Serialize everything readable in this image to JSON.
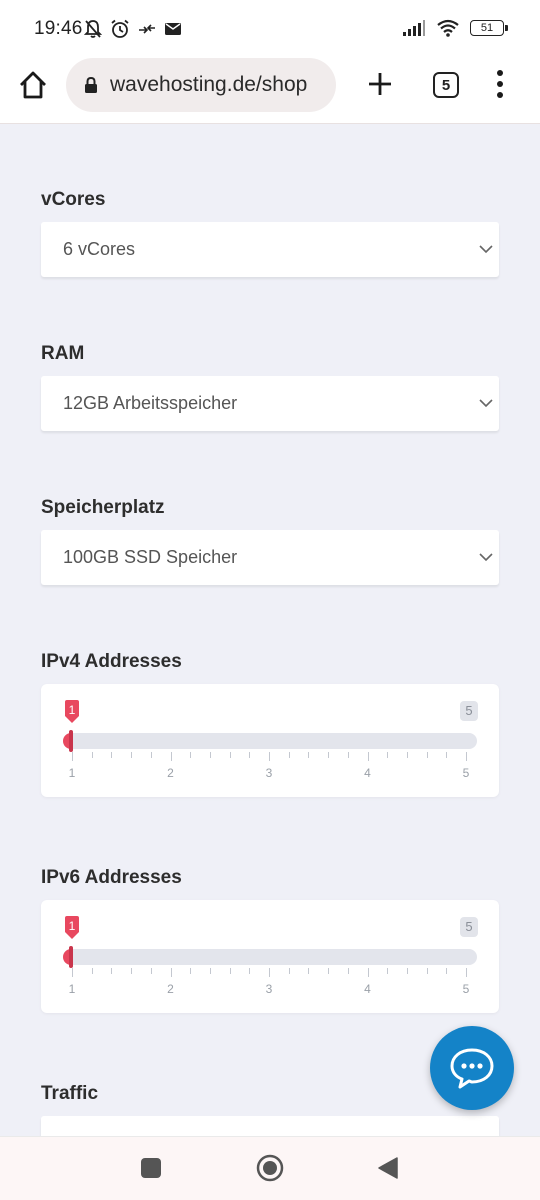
{
  "status": {
    "time": "19:46",
    "battery": "51",
    "icons_left": [
      "bell-off-icon",
      "alarm-icon",
      "data-transfer-icon",
      "mail-icon"
    ],
    "icons_right": [
      "signal-icon",
      "wifi-icon",
      "battery-icon"
    ]
  },
  "browser": {
    "url": "wavehosting.de/shop",
    "tab_count": "5",
    "icons": [
      "home-icon",
      "lock-icon",
      "plus-icon",
      "tabs-icon",
      "more-vert-icon"
    ]
  },
  "form": {
    "vcores": {
      "label": "vCores",
      "value": "6 vCores"
    },
    "ram": {
      "label": "RAM",
      "value": "12GB Arbeitsspeicher"
    },
    "storage": {
      "label": "Speicherplatz",
      "value": "100GB SSD Speicher"
    },
    "ipv4": {
      "label": "IPv4 Addresses",
      "current": "1",
      "max": "5",
      "ticks": [
        "1",
        "2",
        "3",
        "4",
        "5"
      ],
      "fraction": 0
    },
    "ipv6": {
      "label": "IPv6 Addresses",
      "current": "1",
      "max": "5",
      "ticks": [
        "1",
        "2",
        "3",
        "4",
        "5"
      ],
      "fraction": 0
    },
    "traffic": {
      "label": "Traffic"
    }
  },
  "colors": {
    "accent": "#e8485f",
    "chat": "#1483c8",
    "page_bg": "#eff0f7"
  }
}
